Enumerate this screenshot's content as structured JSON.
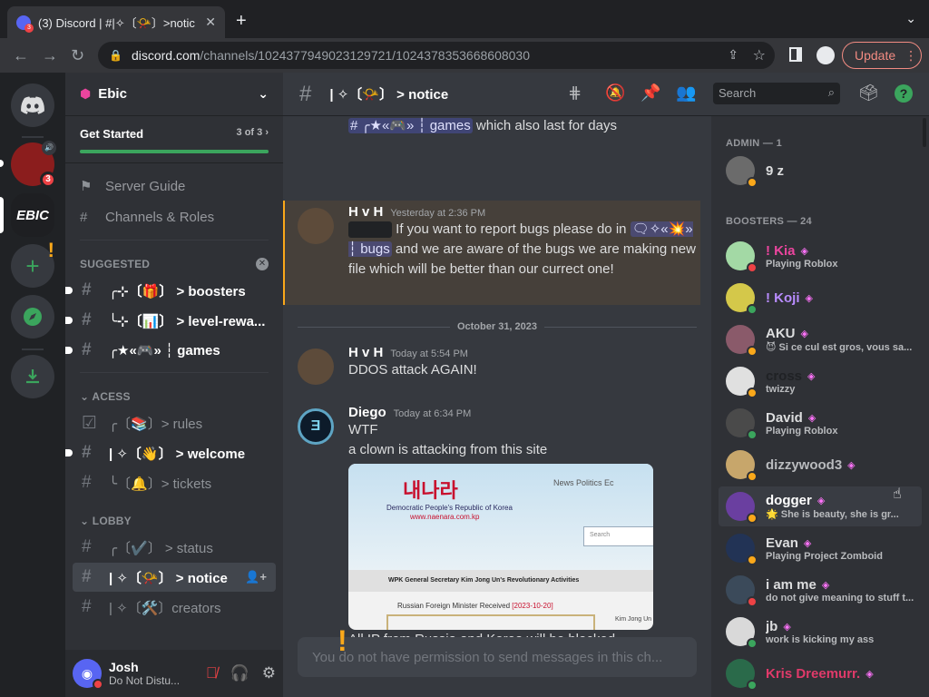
{
  "browser": {
    "tab_title": "(3) Discord | #|✧〔📯〕>notic",
    "tab_badge": "3",
    "url_host": "discord.com",
    "url_path": "/channels/1024377949023129721/1024378353668608030",
    "update_label": "Update"
  },
  "rail": {
    "badge_count": "3",
    "ebic_label": "EBIC"
  },
  "guild": {
    "name": "Ebic",
    "get_started": "Get Started",
    "progress_text": "3 of 3",
    "progress_fraction": 1.0,
    "nav": [
      {
        "label": "Server Guide",
        "icon": "signpost-icon"
      },
      {
        "label": "Channels & Roles",
        "icon": "channels-roles-icon"
      }
    ],
    "categories": {
      "suggested": "SUGGESTED",
      "acess": "ACESS",
      "lobby": "LOBBY"
    },
    "suggested": [
      {
        "label": "╭⊹〔🎁〕 > boosters",
        "unread": true
      },
      {
        "label": "╰⊹〔📊〕 > level-rewa...",
        "unread": true
      },
      {
        "label": "╭★«🎮» ┆ games",
        "unread": true
      }
    ],
    "acess": [
      {
        "label": "╭〔📚〕> rules",
        "unread": false
      },
      {
        "label": "| ✧〔👋〕 > welcome",
        "unread": true
      },
      {
        "label": "╰〔🔔〕> tickets",
        "unread": false
      }
    ],
    "lobby": [
      {
        "label": "╭〔✔️〕 > status",
        "unread": false
      },
      {
        "label": "| ✧〔📯〕 > notice",
        "selected": true
      },
      {
        "label": "| ✧〔🛠️〕creators",
        "unread": false
      }
    ]
  },
  "user": {
    "name": "Josh",
    "status": "Do Not Distu..."
  },
  "channel": {
    "name": "| ✧〔📯〕 > notice"
  },
  "search": {
    "placeholder": "Search"
  },
  "messages": {
    "partial_top": {
      "mention": "# ╭★«🎮» ┆ games",
      "text": " which also last for days"
    },
    "m1": {
      "author": "H v H",
      "time": "Yesterday at 2:36 PM",
      "text_a": " If you want to report bugs please do in ",
      "mention": "🗨✧«💥» ┆ bugs",
      "text_b": " and we are aware of the bugs we are making new file which will be better than our currect one!"
    },
    "date_divider": "October 31, 2023",
    "m2": {
      "author": "H v H",
      "time": "Today at 5:54 PM",
      "text": "DDOS attack AGAIN!"
    },
    "m3": {
      "author": "Diego",
      "time": "Today at 6:34 PM",
      "line1": "WTF",
      "line2": "a clown is attacking from this site",
      "line3": "All IP from Russia and Korea will be blocked.",
      "embed": {
        "logo": "내나라",
        "sub1": "Democratic People's Republic of Korea",
        "sub2": "www.naenara.com.kp",
        "nav": "News    Politics    Ec",
        "search": "Search",
        "headline": "WPK General Secretary Kim Jong Un's Revolutionary Activities",
        "article": "Russian Foreign Minister Received",
        "article_date": "[2023-10-20]",
        "side": "Kim Jong Un"
      }
    },
    "composer_placeholder": "You do not have permission to send messages in this ch..."
  },
  "members": {
    "admin_header": "ADMIN — 1",
    "boosters_header": "BOOSTERS — 24",
    "admin": [
      {
        "name": "9 z",
        "activity": "",
        "color": "#dcddde",
        "status": "idle",
        "avatar": "#6b6b6b",
        "booster": false
      }
    ],
    "boosters": [
      {
        "name": "! Kia",
        "activity": "Playing Roblox",
        "color": "#eb459e",
        "status": "dnd",
        "avatar": "#a3d9a5",
        "booster": true
      },
      {
        "name": "! Koji",
        "activity": "",
        "color": "#b98cff",
        "status": "online",
        "avatar": "#d4c84a",
        "booster": true
      },
      {
        "name": "AKU",
        "activity": "😈 Si ce cul est gros, vous sa...",
        "color": "#dcddde",
        "status": "idle",
        "avatar": "#8a5a6a",
        "booster": true
      },
      {
        "name": "cross",
        "activity": "twizzy",
        "color": "#202225",
        "status": "idle",
        "avatar": "#e0e0e0",
        "booster": true
      },
      {
        "name": "David",
        "activity": "Playing Roblox",
        "color": "#dcddde",
        "status": "online",
        "avatar": "#4a4a4a",
        "booster": true
      },
      {
        "name": "dizzywood3",
        "activity": "",
        "color": "#b9bbbe",
        "status": "idle",
        "avatar": "#c7a66b",
        "booster": true
      },
      {
        "name": "dogger",
        "activity": "🌟 She is beauty, she is gr...",
        "color": "#ffffff",
        "status": "idle",
        "avatar": "#6a3fa0",
        "booster": true
      },
      {
        "name": "Evan",
        "activity": "Playing Project Zomboid",
        "color": "#dcddde",
        "status": "idle",
        "avatar": "#223355",
        "booster": true
      },
      {
        "name": "i am me",
        "activity": "do not give meaning to stuff t...",
        "color": "#dcddde",
        "status": "dnd",
        "avatar": "#3b4a5a",
        "booster": true
      },
      {
        "name": "jb",
        "activity": "work is kicking my ass",
        "color": "#dcddde",
        "status": "online",
        "avatar": "#d9d9d9",
        "booster": true
      },
      {
        "name": "Kris Dreemurr.",
        "activity": "",
        "color": "#e03a6a",
        "status": "online",
        "avatar": "#2a6a4a",
        "booster": true
      }
    ]
  }
}
